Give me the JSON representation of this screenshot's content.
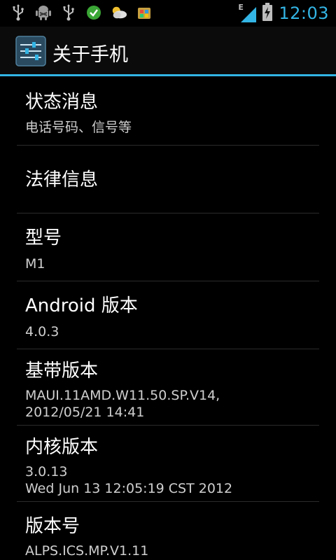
{
  "status_bar": {
    "time": "12:03",
    "network_type": "E",
    "icons_left": [
      "usb-icon",
      "android-debug-icon",
      "usb-icon",
      "check-circle-icon",
      "weather-icon",
      "market-icon"
    ],
    "signal_icon": "signal-icon",
    "battery_icon": "battery-charging-icon",
    "accent_color": "#33b5e5"
  },
  "action_bar": {
    "title": "关于手机",
    "icon": "settings-sliders-icon"
  },
  "items": [
    {
      "title": "状态消息",
      "summary": "电话号码、信号等"
    },
    {
      "title": "法律信息",
      "summary": ""
    },
    {
      "title": "型号",
      "summary": "M1"
    },
    {
      "title": "Android 版本",
      "summary": "4.0.3"
    },
    {
      "title": "基带版本",
      "summary_lines": [
        "MAUI.11AMD.W11.50.SP.V14,",
        "2012/05/21 14:41"
      ]
    },
    {
      "title": "内核版本",
      "summary_lines": [
        "3.0.13",
        "Wed Jun 13 12:05:19 CST 2012"
      ]
    },
    {
      "title": "版本号",
      "summary": "ALPS.ICS.MP.V1.11"
    }
  ]
}
